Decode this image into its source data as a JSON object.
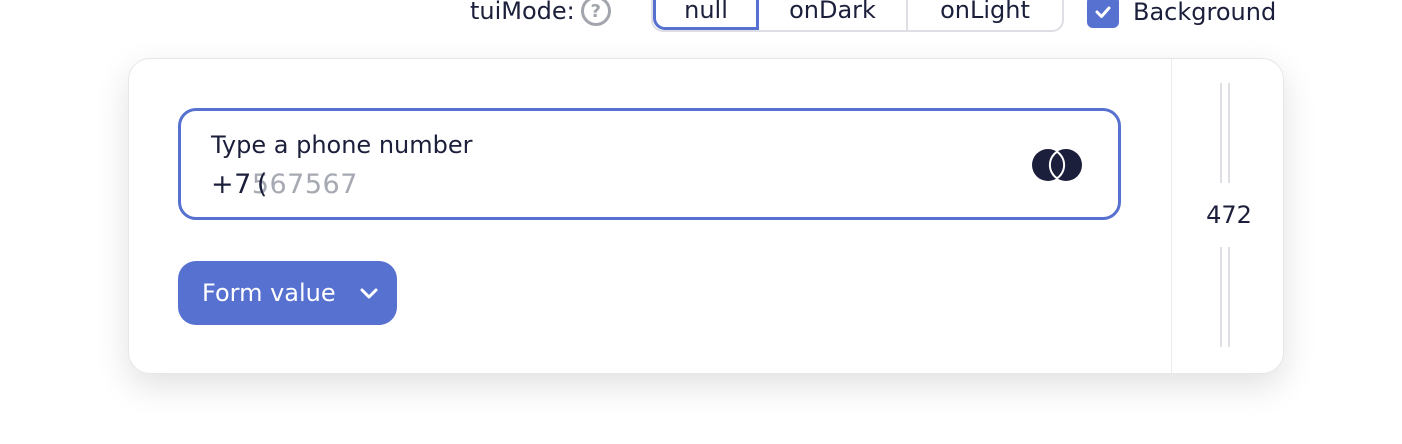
{
  "toolbar": {
    "mode_label": "tuiMode:",
    "modes": [
      "null",
      "onDark",
      "onLight"
    ],
    "active_mode": "null",
    "background_label": "Background",
    "background_checked": true
  },
  "phone_input": {
    "label": "Type a phone number",
    "typed_value": "+7",
    "caret_char": "(",
    "mask_placeholder": "567567"
  },
  "form_button": {
    "label": "Form value"
  },
  "resizer": {
    "width_value": "472"
  },
  "colors": {
    "accent": "#5671d0",
    "text": "#1b1f3b",
    "muted": "#a6a9b2",
    "border": "#dddfe4"
  },
  "icons": {
    "help": "help-circle-icon",
    "checkbox": "checkmark-icon",
    "card": "card-brand-icon",
    "dropdown": "chevron-down-icon"
  }
}
